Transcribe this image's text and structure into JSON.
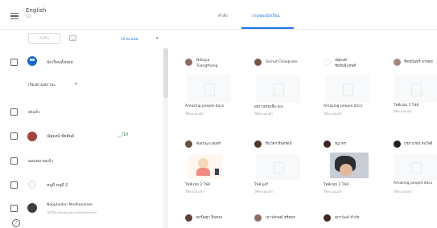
{
  "header": {
    "course_title": "English",
    "course_subtitle": "5/1",
    "tabs": [
      "คำสั่ง",
      "งานของนักเรียน"
    ],
    "active_tab": "งานของนักเรียน"
  },
  "toolbar": {
    "return_label": "ส่งคืน",
    "points_label": "10 คะแนน"
  },
  "student_list": {
    "all_label": "นักเรียนทั้งหมด",
    "sort_label": "เรียงตามสถานะ",
    "section_submitted": "ส่งแล้ว",
    "section_not_submitted": "มอบหมายแล้ว",
    "students": [
      {
        "name": "ณัฐพงษ์ ชัยพันธ์",
        "grade": "__/10"
      },
      {
        "name": "หนูดี หนูดี 2",
        "grade": ""
      },
      {
        "name": "Nopphadon Medhanaram",
        "grade": "",
        "sub": "ไม่ได้ส่ง Nopphadon Medhanaram"
      }
    ]
  },
  "cards": [
    {
      "name": "Nittaya\nTuangthong",
      "status": "Amazing people.docx",
      "sub": "ให้คะแนนแล้ว"
    },
    {
      "name": "Sirinut Chaopram",
      "status": "ผลงานหนังสือ.doc",
      "sub": "ให้คะแนนแล้ว"
    },
    {
      "name": "ณัฐพงษ์\nชัยพันธ์แสนดี",
      "status": "Amazing people.docx",
      "sub": "ให้คะแนนแล้ว"
    },
    {
      "name": "ชิตชนินทร์ สายสุข",
      "status": "ไฟล์แนบ 1 ไฟล์",
      "sub": "ให้คะแนนแล้ว"
    },
    {
      "name": "Nattaya สุนทร",
      "status": "ไฟล์แนบ 2 ไฟล์",
      "sub": "ให้คะแนนแล้ว"
    },
    {
      "name": "ชินวัตร ทิพยรัตน์",
      "status": "ไฟล์.pdf",
      "sub": "ให้คะแนนแล้ว"
    },
    {
      "name": "ชฎาพร",
      "status": "ไฟล์แนบ 2 ไฟล์",
      "sub": "ให้คะแนนแล้ว"
    },
    {
      "name": "ปรมาภรณ์ สนใจดี",
      "status": "Amazing people.docx",
      "sub": "ให้คะแนนแล้ว"
    },
    {
      "name": "ศุภนิษฐา ปิ่นทอง",
      "status": "",
      "sub": ""
    },
    {
      "name": "เยาวลักษณ์ ศรีสมร",
      "status": "",
      "sub": ""
    },
    {
      "name": "สุภาวัฒน์ นำภัย",
      "status": "",
      "sub": ""
    }
  ]
}
